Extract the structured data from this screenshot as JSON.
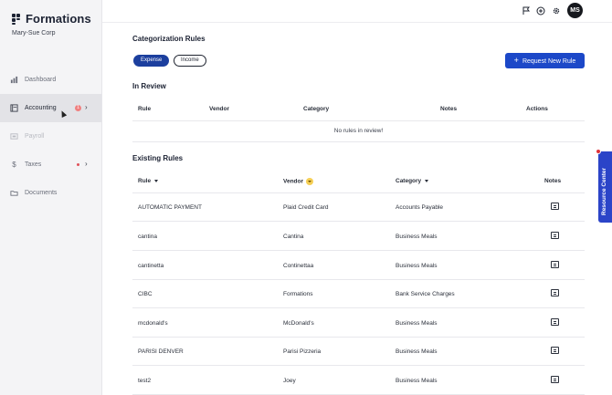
{
  "sidebar": {
    "logo_text": "Formations",
    "company": "Mary-Sue Corp",
    "items": [
      {
        "label": "Dashboard",
        "icon": "chart-icon"
      },
      {
        "label": "Accounting",
        "icon": "ledger-icon",
        "badge": "1"
      },
      {
        "label": "Payroll",
        "icon": "payroll-icon"
      },
      {
        "label": "Taxes",
        "icon": "dollar-icon"
      },
      {
        "label": "Documents",
        "icon": "folder-icon"
      }
    ]
  },
  "topbar": {
    "avatar_initials": "MS",
    "icons": [
      "flag-icon",
      "plus-circle-icon",
      "gear-icon"
    ]
  },
  "categorization": {
    "title": "Categorization Rules",
    "pills": [
      "Expense",
      "Income"
    ],
    "request_button": "Request New Rule"
  },
  "in_review": {
    "title": "In Review",
    "columns": [
      "Rule",
      "Vendor",
      "Category",
      "Notes",
      "Actions"
    ],
    "empty_text": "No rules in review!"
  },
  "existing_rules": {
    "title": "Existing Rules",
    "columns": [
      "Rule",
      "Vendor",
      "Category",
      "Notes"
    ],
    "rows": [
      {
        "rule": "AUTOMATIC PAYMENT",
        "vendor": "Plaid Credit Card",
        "category": "Accounts Payable"
      },
      {
        "rule": "cantina",
        "vendor": "Cantina",
        "category": "Business Meals"
      },
      {
        "rule": "cantinetta",
        "vendor": "Continettaa",
        "category": "Business Meals"
      },
      {
        "rule": "CIBC",
        "vendor": "Formations",
        "category": "Bank Service Charges"
      },
      {
        "rule": "mcdonald's",
        "vendor": "McDonald's",
        "category": "Business Meals"
      },
      {
        "rule": "PARISI DENVER",
        "vendor": "Parisi Pizzeria",
        "category": "Business Meals"
      },
      {
        "rule": "test2",
        "vendor": "Joey",
        "category": "Business Meals"
      }
    ]
  },
  "resource_center": {
    "label": "Resource Center"
  }
}
